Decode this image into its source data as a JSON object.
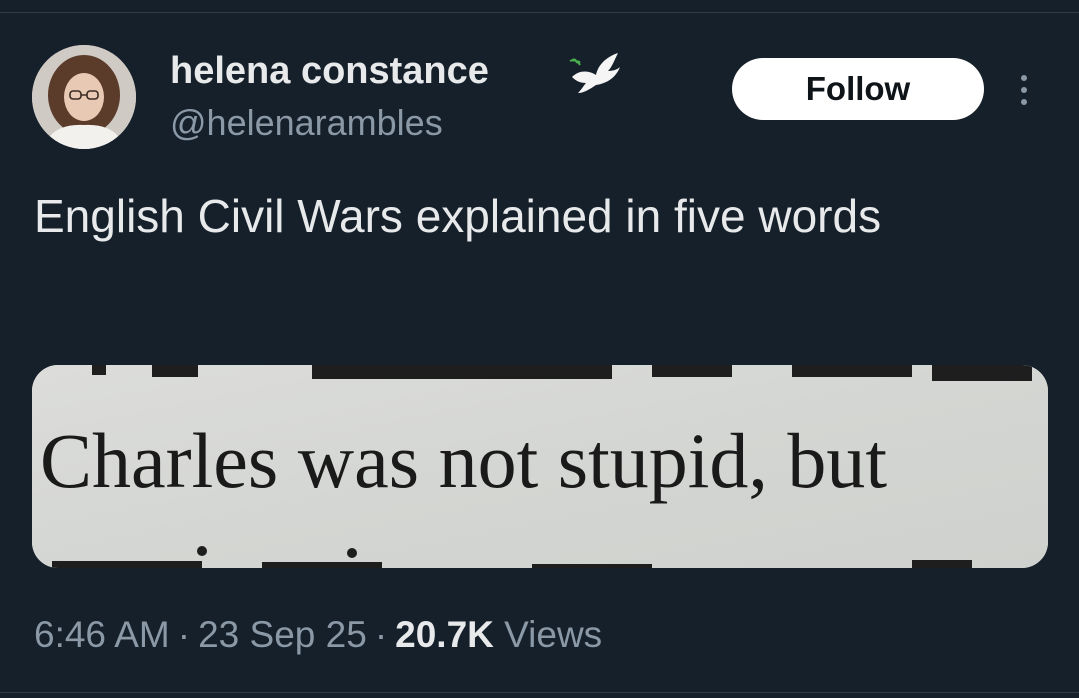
{
  "tweet": {
    "author": {
      "display_name": "helena constance",
      "handle": "@helenarambles",
      "badge_icon": "dove-icon"
    },
    "follow_label": "Follow",
    "more_icon": "more-vertical-icon",
    "text": "English Civil Wars explained in five words",
    "media": {
      "visible_text": "Charles was not stupid, but"
    },
    "meta": {
      "time": "6:46 AM",
      "separator": "·",
      "date": "23 Sep 25",
      "views_count": "20.7K",
      "views_label": "Views"
    }
  },
  "colors": {
    "background": "#15202b",
    "primary_text": "#e7e9ea",
    "secondary_text": "#8b98a5",
    "button_bg": "#ffffff",
    "button_text": "#0f1419"
  }
}
